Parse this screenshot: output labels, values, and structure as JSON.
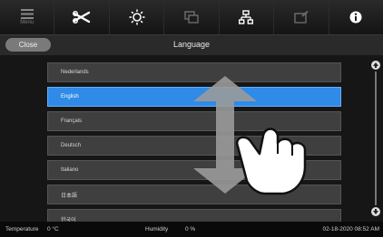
{
  "toolbar": {
    "menu_label": "Menu",
    "icons": [
      "menu-icon",
      "tools-icon",
      "brightness-icon",
      "display-icon",
      "network-icon",
      "settings-icon",
      "info-icon"
    ]
  },
  "header": {
    "close_label": "Close",
    "title": "Language"
  },
  "languages": [
    {
      "label": "Nederlands",
      "selected": false
    },
    {
      "label": "English",
      "selected": true
    },
    {
      "label": "Français",
      "selected": false
    },
    {
      "label": "Deutsch",
      "selected": false
    },
    {
      "label": "Italiano",
      "selected": false
    },
    {
      "label": "日本語",
      "selected": false
    },
    {
      "label": "한국어",
      "selected": false
    }
  ],
  "status": {
    "temperature_label": "Temperature",
    "temperature_value": "0 °C",
    "humidity_label": "Humidity",
    "humidity_value": "0 %",
    "datetime": "02-18-2020 08:52 AM"
  },
  "colors": {
    "selected": "#2f8ae8",
    "item": "#3f3f3f"
  }
}
